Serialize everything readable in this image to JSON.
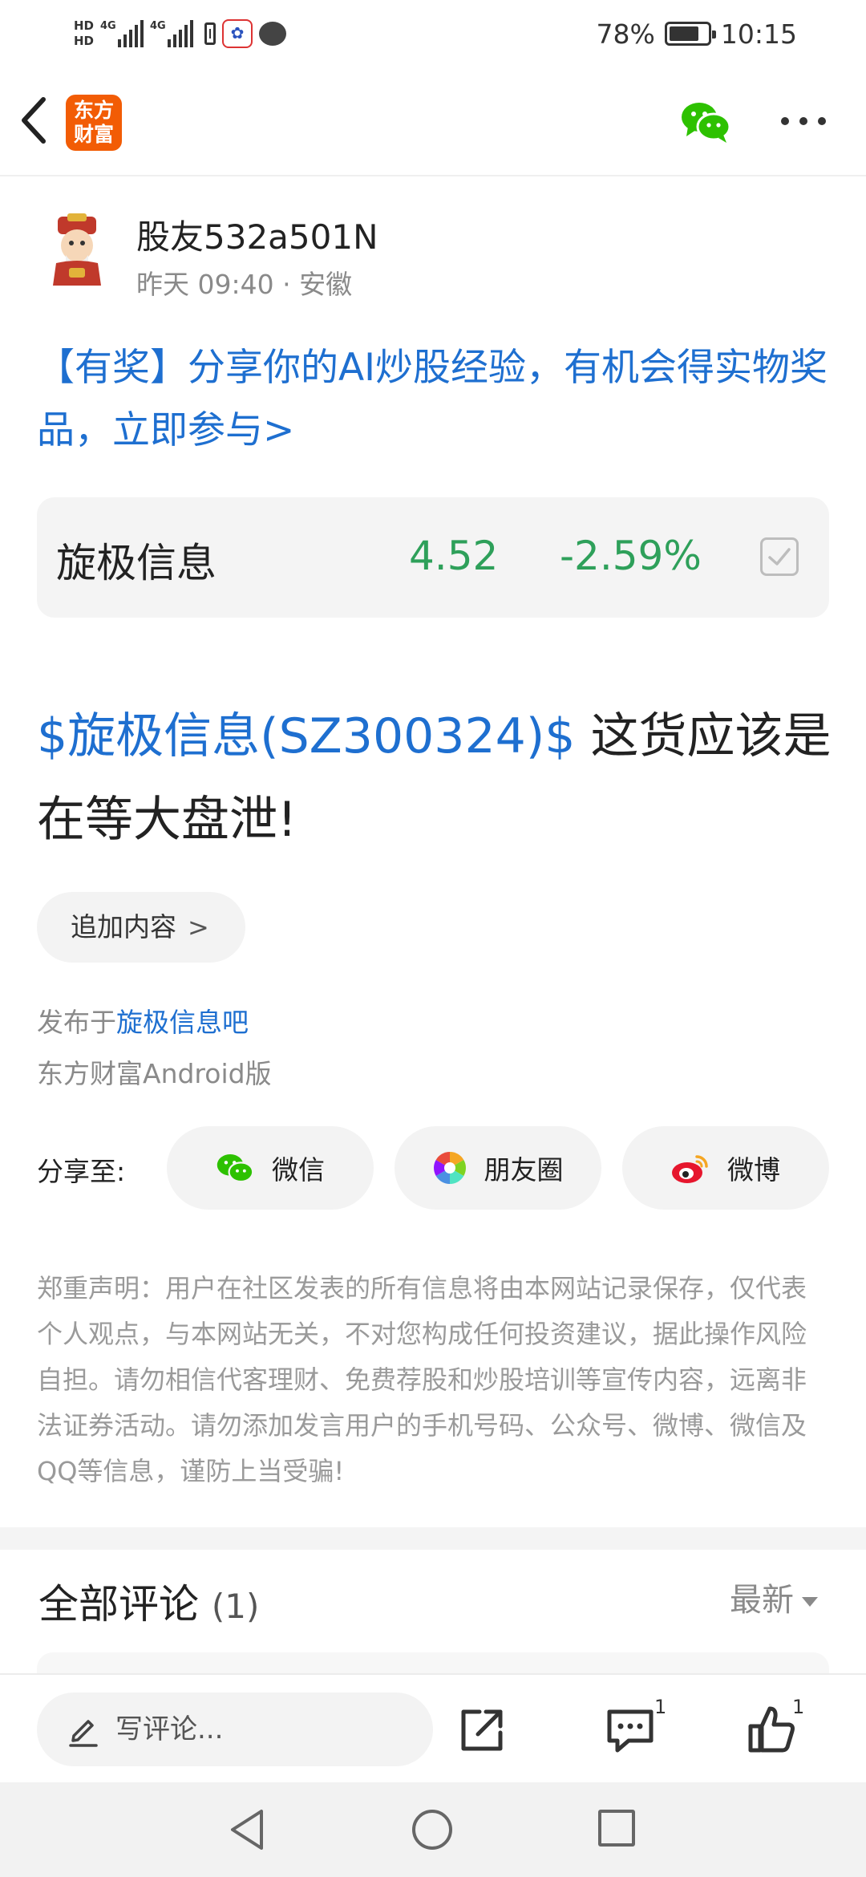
{
  "status_bar": {
    "hd1": "HD",
    "hd2": "HD",
    "net1": "4G",
    "net2": "4G",
    "battery_percent": "78%",
    "time": "10:15"
  },
  "header": {
    "logo_line1": "东方",
    "logo_line2": "财富"
  },
  "author": {
    "name": "股友532a501N",
    "time": "昨天 09:40",
    "separator": "·",
    "location": "安徽"
  },
  "promo": {
    "text": "【有奖】分享你的AI炒股经验，有机会得实物奖品，立即参与>"
  },
  "stock_card": {
    "name": "旋极信息",
    "price": "4.52",
    "change": "-2.59%",
    "change_color": "#2ea05a"
  },
  "post": {
    "stock_tag": "$旋极信息(SZ300324)$",
    "body": " 这货应该是在等大盘泄!"
  },
  "append_button": {
    "label": "追加内容",
    "chevron": ">"
  },
  "meta": {
    "posted_prefix": "发布于",
    "bar_name": "旋极信息吧",
    "client": "东方财富Android版"
  },
  "share": {
    "label": "分享至:",
    "wechat": "微信",
    "moments": "朋友圈",
    "weibo": "微博"
  },
  "disclaimer": "郑重声明：用户在社区发表的所有信息将由本网站记录保存，仅代表个人观点，与本网站无关，不对您构成任何投资建议，据此操作风险自担。请勿相信代客理财、免费荐股和炒股培训等宣传内容，远离非法证券活动。请勿添加发言用户的手机号码、公众号、微博、微信及QQ等信息，谨防上当受骗!",
  "comments": {
    "title": "全部评论",
    "count": "(1)",
    "sort_label": "最新"
  },
  "action_bar": {
    "input_placeholder": "写评论...",
    "comment_count": "1",
    "like_count": "1"
  },
  "colors": {
    "link_blue": "#1e6fd0",
    "brand_orange": "#f25c05",
    "down_green": "#2ea05a"
  }
}
